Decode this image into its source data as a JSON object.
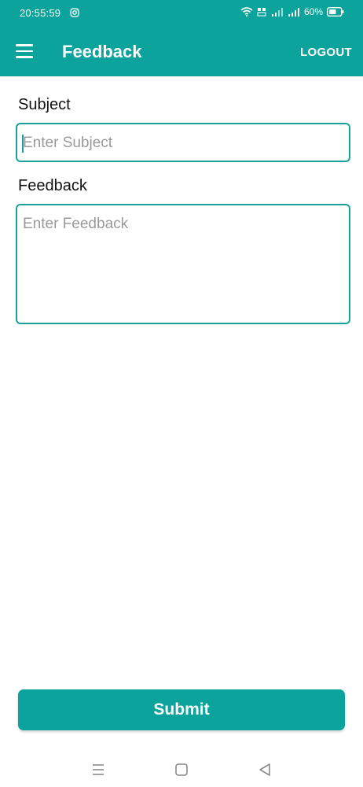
{
  "status_bar": {
    "time": "20:55:59",
    "battery": "60%",
    "icons": [
      "instagram-icon",
      "wifi-icon",
      "volte-icon",
      "signal-icon",
      "signal-icon",
      "battery-icon"
    ]
  },
  "app_bar": {
    "menu_icon": "hamburger-menu-icon",
    "title": "Feedback",
    "logout_label": "LOGOUT",
    "background_color": "#0ba39b"
  },
  "form": {
    "subject_label": "Subject",
    "subject_placeholder": "Enter Subject",
    "subject_value": "",
    "feedback_label": "Feedback",
    "feedback_placeholder": "Enter Feedback",
    "feedback_value": "",
    "field_border_color": "#17a39a"
  },
  "submit_label": "Submit",
  "nav_bar": {
    "icons": [
      "recents-icon",
      "home-icon",
      "back-icon"
    ]
  }
}
